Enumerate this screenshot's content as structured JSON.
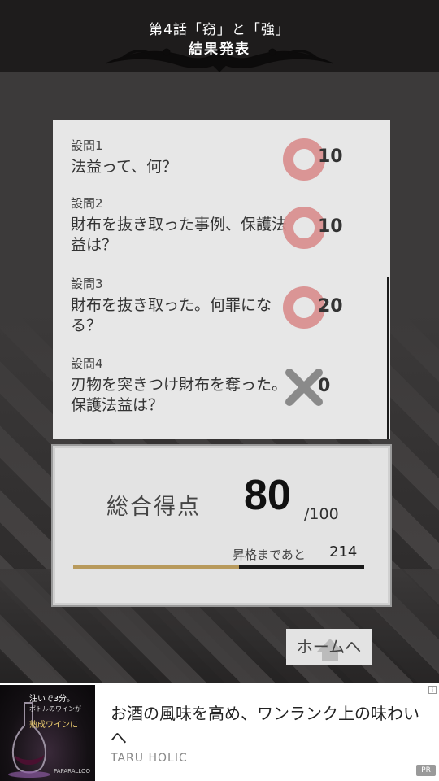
{
  "header": {
    "title": "第4話「窃」と「強」",
    "subtitle": "結果発表"
  },
  "questions": [
    {
      "num": "設問1",
      "text": "法益って、何？",
      "result": "correct",
      "score": "10"
    },
    {
      "num": "設問2",
      "text": "財布を抜き取った事例、保護法益は？",
      "result": "correct",
      "score": "10"
    },
    {
      "num": "設問3",
      "text": "財布を抜き取った。何罪になる？",
      "result": "correct",
      "score": "20"
    },
    {
      "num": "設問4",
      "text": "刃物を突きつけ財布を奪った。保護法益は？",
      "result": "wrong",
      "score": "0"
    }
  ],
  "total": {
    "label": "総合得点",
    "value": "80",
    "max": "/100",
    "next_label": "昇格まであと",
    "next_value": "214",
    "progress": 0.57
  },
  "home_button": {
    "label": "ホームへ"
  },
  "ad": {
    "headline": "お酒の風味を高め、ワンランク上の味わいへ",
    "advertiser": "TARU HOLIC",
    "pr_label": "PR",
    "thumb_line1": "注いで3分。",
    "thumb_line2": "ボトルのワインが",
    "thumb_line3": "熟成ワインに",
    "thumb_brand": "PAPARALLOO"
  },
  "colors": {
    "correct_mark": "#d98e8e",
    "wrong_mark": "#8a8a8a",
    "progress_fill": "#b89a5c",
    "header_bg": "#1e1c1c"
  }
}
